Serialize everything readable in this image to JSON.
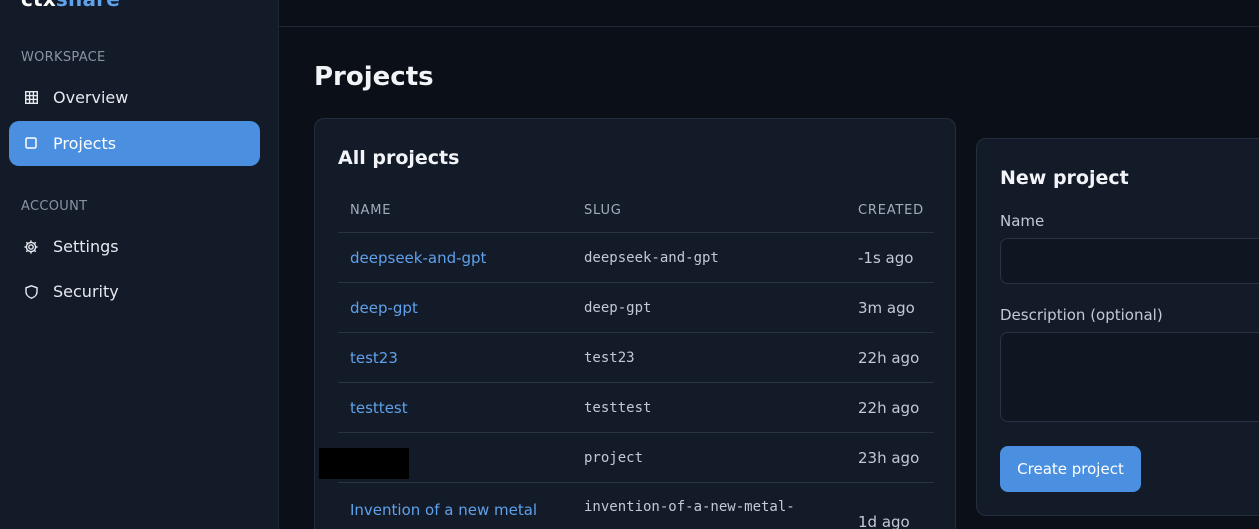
{
  "brand": {
    "part1": "ctx",
    "part2": "share"
  },
  "sidebar": {
    "sections": [
      {
        "label": "WORKSPACE"
      },
      {
        "label": "ACCOUNT"
      }
    ],
    "items": [
      {
        "label": "Overview",
        "icon": "grid-icon",
        "active": false
      },
      {
        "label": "Projects",
        "icon": "square-icon",
        "active": true
      },
      {
        "label": "Settings",
        "icon": "gear-icon",
        "active": false
      },
      {
        "label": "Security",
        "icon": "shield-icon",
        "active": false
      }
    ]
  },
  "main": {
    "title": "Projects",
    "projects_card": {
      "title": "All projects",
      "columns": [
        "NAME",
        "SLUG",
        "CREATED"
      ],
      "rows": [
        {
          "name": "deepseek-and-gpt",
          "slug": "deepseek-and-gpt",
          "created": "-1s ago"
        },
        {
          "name": "deep-gpt",
          "slug": "deep-gpt",
          "created": "3m ago"
        },
        {
          "name": "test23",
          "slug": "test23",
          "created": "22h ago"
        },
        {
          "name": "testtest",
          "slug": "testtest",
          "created": "22h ago"
        },
        {
          "name": "",
          "slug": "project",
          "created": "23h ago"
        },
        {
          "name": "Invention of a new metal",
          "slug": "invention-of-a-new-metal-",
          "created": "1d ago"
        }
      ]
    },
    "new_project": {
      "title": "New project",
      "name_label": "Name",
      "name_value": "",
      "description_label": "Description (optional)",
      "description_value": "",
      "submit_label": "Create project"
    }
  },
  "colors": {
    "accent": "#4a8fe0",
    "link": "#5fa1ea",
    "sidebar_bg": "#131a28",
    "page_bg": "#0b0f17"
  }
}
